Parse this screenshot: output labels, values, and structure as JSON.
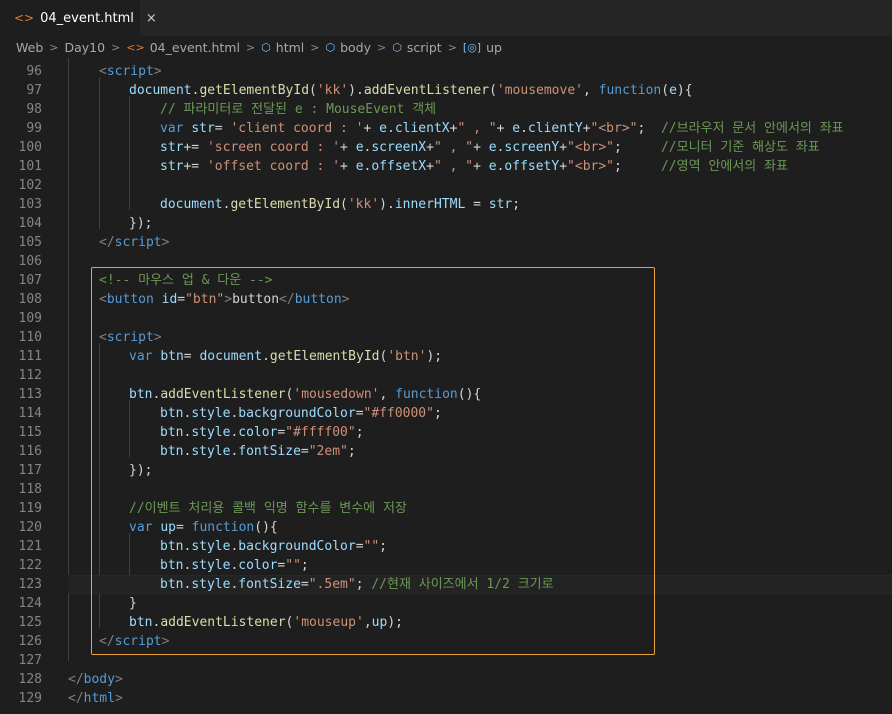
{
  "tab": {
    "icon": "html-file-icon",
    "title": "04_event.html",
    "close": "×"
  },
  "breadcrumb": [
    "Web",
    "Day10",
    "04_event.html",
    "html",
    "body",
    "script",
    "up"
  ],
  "lines": [
    {
      "n": "96",
      "toks": [
        [
          "t-brk",
          "<"
        ],
        [
          "t-tag",
          "script"
        ],
        [
          "t-brk",
          ">"
        ]
      ],
      "indent": 1
    },
    {
      "n": "97",
      "toks": [
        [
          "t-var",
          "document"
        ],
        [
          "t-punc",
          "."
        ],
        [
          "t-fn",
          "getElementById"
        ],
        [
          "t-punc",
          "("
        ],
        [
          "t-str",
          "'kk'"
        ],
        [
          "t-punc",
          ")."
        ],
        [
          "t-fn",
          "addEventListener"
        ],
        [
          "t-punc",
          "("
        ],
        [
          "t-str",
          "'mousemove'"
        ],
        [
          "t-punc",
          ", "
        ],
        [
          "t-kw",
          "function"
        ],
        [
          "t-punc",
          "("
        ],
        [
          "t-var",
          "e"
        ],
        [
          "t-punc",
          "){"
        ]
      ],
      "indent": 2
    },
    {
      "n": "98",
      "toks": [
        [
          "t-com",
          "// 파라미터로 전달된 e : MouseEvent 객체"
        ]
      ],
      "indent": 3
    },
    {
      "n": "99",
      "toks": [
        [
          "t-kw",
          "var "
        ],
        [
          "t-var",
          "str"
        ],
        [
          "t-punc",
          "= "
        ],
        [
          "t-str",
          "'client coord : '"
        ],
        [
          "t-punc",
          "+ "
        ],
        [
          "t-var",
          "e"
        ],
        [
          "t-punc",
          "."
        ],
        [
          "t-var",
          "clientX"
        ],
        [
          "t-punc",
          "+"
        ],
        [
          "t-str",
          "\" , \""
        ],
        [
          "t-punc",
          "+ "
        ],
        [
          "t-var",
          "e"
        ],
        [
          "t-punc",
          "."
        ],
        [
          "t-var",
          "clientY"
        ],
        [
          "t-punc",
          "+"
        ],
        [
          "t-str",
          "\"<br>\""
        ],
        [
          "t-punc",
          ";  "
        ],
        [
          "t-com",
          "//브라우저 문서 안에서의 좌표"
        ]
      ],
      "indent": 3
    },
    {
      "n": "100",
      "toks": [
        [
          "t-var",
          "str"
        ],
        [
          "t-punc",
          "+= "
        ],
        [
          "t-str",
          "'screen coord : '"
        ],
        [
          "t-punc",
          "+ "
        ],
        [
          "t-var",
          "e"
        ],
        [
          "t-punc",
          "."
        ],
        [
          "t-var",
          "screenX"
        ],
        [
          "t-punc",
          "+"
        ],
        [
          "t-str",
          "\" , \""
        ],
        [
          "t-punc",
          "+ "
        ],
        [
          "t-var",
          "e"
        ],
        [
          "t-punc",
          "."
        ],
        [
          "t-var",
          "screenY"
        ],
        [
          "t-punc",
          "+"
        ],
        [
          "t-str",
          "\"<br>\""
        ],
        [
          "t-punc",
          ";     "
        ],
        [
          "t-com",
          "//모니터 기준 해상도 좌표"
        ]
      ],
      "indent": 3
    },
    {
      "n": "101",
      "toks": [
        [
          "t-var",
          "str"
        ],
        [
          "t-punc",
          "+= "
        ],
        [
          "t-str",
          "'offset coord : '"
        ],
        [
          "t-punc",
          "+ "
        ],
        [
          "t-var",
          "e"
        ],
        [
          "t-punc",
          "."
        ],
        [
          "t-var",
          "offsetX"
        ],
        [
          "t-punc",
          "+"
        ],
        [
          "t-str",
          "\" , \""
        ],
        [
          "t-punc",
          "+ "
        ],
        [
          "t-var",
          "e"
        ],
        [
          "t-punc",
          "."
        ],
        [
          "t-var",
          "offsetY"
        ],
        [
          "t-punc",
          "+"
        ],
        [
          "t-str",
          "\"<br>\""
        ],
        [
          "t-punc",
          ";     "
        ],
        [
          "t-com",
          "//영역 안에서의 좌표"
        ]
      ],
      "indent": 3
    },
    {
      "n": "102",
      "toks": [],
      "indent": 0
    },
    {
      "n": "103",
      "toks": [
        [
          "t-var",
          "document"
        ],
        [
          "t-punc",
          "."
        ],
        [
          "t-fn",
          "getElementById"
        ],
        [
          "t-punc",
          "("
        ],
        [
          "t-str",
          "'kk'"
        ],
        [
          "t-punc",
          ")."
        ],
        [
          "t-var",
          "innerHTML"
        ],
        [
          "t-punc",
          " = "
        ],
        [
          "t-var",
          "str"
        ],
        [
          "t-punc",
          ";"
        ]
      ],
      "indent": 3
    },
    {
      "n": "104",
      "toks": [
        [
          "t-punc",
          "});"
        ]
      ],
      "indent": 2
    },
    {
      "n": "105",
      "toks": [
        [
          "t-brk",
          "</"
        ],
        [
          "t-tag",
          "script"
        ],
        [
          "t-brk",
          ">"
        ]
      ],
      "indent": 1
    },
    {
      "n": "106",
      "toks": [],
      "indent": 0
    },
    {
      "n": "107",
      "toks": [
        [
          "t-com",
          "<!-- 마우스 업 & 다운 -->"
        ]
      ],
      "indent": 1
    },
    {
      "n": "108",
      "toks": [
        [
          "t-brk",
          "<"
        ],
        [
          "t-tag",
          "button"
        ],
        [
          "t-attr",
          " id"
        ],
        [
          "t-punc",
          "="
        ],
        [
          "t-str",
          "\"btn\""
        ],
        [
          "t-brk",
          ">"
        ],
        [
          "t-txt",
          "button"
        ],
        [
          "t-brk",
          "</"
        ],
        [
          "t-tag",
          "button"
        ],
        [
          "t-brk",
          ">"
        ]
      ],
      "indent": 1
    },
    {
      "n": "109",
      "toks": [],
      "indent": 0
    },
    {
      "n": "110",
      "toks": [
        [
          "t-brk",
          "<"
        ],
        [
          "t-tag",
          "script"
        ],
        [
          "t-brk",
          ">"
        ]
      ],
      "indent": 1
    },
    {
      "n": "111",
      "toks": [
        [
          "t-kw",
          "var "
        ],
        [
          "t-var",
          "btn"
        ],
        [
          "t-punc",
          "= "
        ],
        [
          "t-var",
          "document"
        ],
        [
          "t-punc",
          "."
        ],
        [
          "t-fn",
          "getElementById"
        ],
        [
          "t-punc",
          "("
        ],
        [
          "t-str",
          "'btn'"
        ],
        [
          "t-punc",
          ");"
        ]
      ],
      "indent": 2
    },
    {
      "n": "112",
      "toks": [],
      "indent": 0
    },
    {
      "n": "113",
      "toks": [
        [
          "t-var",
          "btn"
        ],
        [
          "t-punc",
          "."
        ],
        [
          "t-fn",
          "addEventListener"
        ],
        [
          "t-punc",
          "("
        ],
        [
          "t-str",
          "'mousedown'"
        ],
        [
          "t-punc",
          ", "
        ],
        [
          "t-kw",
          "function"
        ],
        [
          "t-punc",
          "(){"
        ]
      ],
      "indent": 2
    },
    {
      "n": "114",
      "toks": [
        [
          "t-var",
          "btn"
        ],
        [
          "t-punc",
          "."
        ],
        [
          "t-var",
          "style"
        ],
        [
          "t-punc",
          "."
        ],
        [
          "t-var",
          "backgroundColor"
        ],
        [
          "t-punc",
          "="
        ],
        [
          "t-str",
          "\"#ff0000\""
        ],
        [
          "t-punc",
          ";"
        ]
      ],
      "indent": 3
    },
    {
      "n": "115",
      "toks": [
        [
          "t-var",
          "btn"
        ],
        [
          "t-punc",
          "."
        ],
        [
          "t-var",
          "style"
        ],
        [
          "t-punc",
          "."
        ],
        [
          "t-var",
          "color"
        ],
        [
          "t-punc",
          "="
        ],
        [
          "t-str",
          "\"#ffff00\""
        ],
        [
          "t-punc",
          ";"
        ]
      ],
      "indent": 3
    },
    {
      "n": "116",
      "toks": [
        [
          "t-var",
          "btn"
        ],
        [
          "t-punc",
          "."
        ],
        [
          "t-var",
          "style"
        ],
        [
          "t-punc",
          "."
        ],
        [
          "t-var",
          "fontSize"
        ],
        [
          "t-punc",
          "="
        ],
        [
          "t-str",
          "\"2em\""
        ],
        [
          "t-punc",
          ";"
        ]
      ],
      "indent": 3
    },
    {
      "n": "117",
      "toks": [
        [
          "t-punc",
          "});"
        ]
      ],
      "indent": 2
    },
    {
      "n": "118",
      "toks": [],
      "indent": 0
    },
    {
      "n": "119",
      "toks": [
        [
          "t-com",
          "//이벤트 처리용 콜백 익명 함수를 변수에 저장"
        ]
      ],
      "indent": 2
    },
    {
      "n": "120",
      "toks": [
        [
          "t-kw",
          "var "
        ],
        [
          "t-var",
          "up"
        ],
        [
          "t-punc",
          "= "
        ],
        [
          "t-kw",
          "function"
        ],
        [
          "t-punc",
          "(){"
        ]
      ],
      "indent": 2
    },
    {
      "n": "121",
      "toks": [
        [
          "t-var",
          "btn"
        ],
        [
          "t-punc",
          "."
        ],
        [
          "t-var",
          "style"
        ],
        [
          "t-punc",
          "."
        ],
        [
          "t-var",
          "backgroundColor"
        ],
        [
          "t-punc",
          "="
        ],
        [
          "t-str",
          "\"\""
        ],
        [
          "t-punc",
          ";"
        ]
      ],
      "indent": 3
    },
    {
      "n": "122",
      "toks": [
        [
          "t-var",
          "btn"
        ],
        [
          "t-punc",
          "."
        ],
        [
          "t-var",
          "style"
        ],
        [
          "t-punc",
          "."
        ],
        [
          "t-var",
          "color"
        ],
        [
          "t-punc",
          "="
        ],
        [
          "t-str",
          "\"\""
        ],
        [
          "t-punc",
          ";"
        ]
      ],
      "indent": 3
    },
    {
      "n": "123",
      "toks": [
        [
          "t-var",
          "btn"
        ],
        [
          "t-punc",
          "."
        ],
        [
          "t-var",
          "style"
        ],
        [
          "t-punc",
          "."
        ],
        [
          "t-var",
          "fontSize"
        ],
        [
          "t-punc",
          "="
        ],
        [
          "t-str",
          "\".5em\""
        ],
        [
          "t-punc",
          "; "
        ],
        [
          "t-com",
          "//현재 사이즈에서 1/2 크기로"
        ]
      ],
      "indent": 3
    },
    {
      "n": "124",
      "toks": [
        [
          "t-punc",
          "}"
        ]
      ],
      "indent": 2
    },
    {
      "n": "125",
      "toks": [
        [
          "t-var",
          "btn"
        ],
        [
          "t-punc",
          "."
        ],
        [
          "t-fn",
          "addEventListener"
        ],
        [
          "t-punc",
          "("
        ],
        [
          "t-str",
          "'mouseup'"
        ],
        [
          "t-punc",
          ","
        ],
        [
          "t-var",
          "up"
        ],
        [
          "t-punc",
          ");"
        ]
      ],
      "indent": 2
    },
    {
      "n": "126",
      "toks": [
        [
          "t-brk",
          "</"
        ],
        [
          "t-tag",
          "script"
        ],
        [
          "t-brk",
          ">"
        ]
      ],
      "indent": 1
    },
    {
      "n": "127",
      "toks": [],
      "indent": 0
    },
    {
      "n": "128",
      "toks": [
        [
          "t-brk",
          "</"
        ],
        [
          "t-tag",
          "body"
        ],
        [
          "t-brk",
          ">"
        ]
      ],
      "indent": 0
    },
    {
      "n": "129",
      "toks": [
        [
          "t-brk",
          "</"
        ],
        [
          "t-tag",
          "html"
        ],
        [
          "t-brk",
          ">"
        ]
      ],
      "indent": 0
    }
  ]
}
